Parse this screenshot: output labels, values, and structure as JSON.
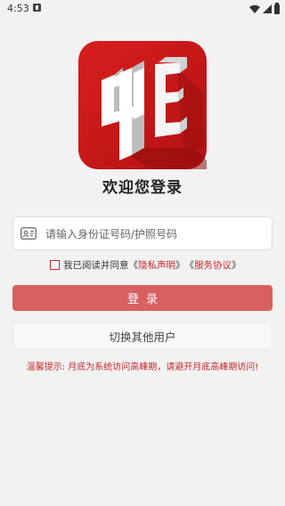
{
  "status_bar": {
    "time": "4:53"
  },
  "welcome_title": "欢迎您登录",
  "id_input": {
    "placeholder": "请输入身份证号码/护照号码",
    "value": ""
  },
  "agreement": {
    "prefix": "我已阅读并同意",
    "privacy_open": "《",
    "privacy_label": "隐私声明",
    "privacy_close": "》",
    "service_open": "《",
    "service_label": "服务协议",
    "service_close": "》",
    "checked": false
  },
  "login_button": "登录",
  "switch_user_button": "切换其他用户",
  "tip_text": "温馨提示: 月底为系统访问高峰期，请避开月底高峰期访问!",
  "colors": {
    "brand_red": "#c62828",
    "button_red": "#d96061",
    "background": "#f3f2f2"
  },
  "icons": [
    "notification-icon",
    "wifi-icon",
    "signal-icon",
    "battery-icon",
    "id-card-icon",
    "app-logo"
  ]
}
